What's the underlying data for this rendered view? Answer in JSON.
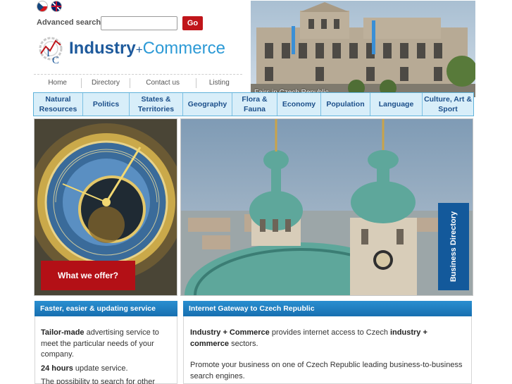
{
  "header": {
    "languages": [
      {
        "code": "cz",
        "icon": "czech-flag-icon"
      },
      {
        "code": "en",
        "icon": "uk-flag-icon"
      }
    ],
    "advanced_search_label": "Advanced search",
    "search_value": "",
    "go_label": "Go",
    "logo": {
      "word1": "Industry",
      "plus": "+",
      "word2": "Commerce",
      "mark_letters": "I C"
    },
    "nav": [
      "Home",
      "Directory",
      "Contact us",
      "Listing"
    ],
    "photo_caption": "Fairs in Czech Republic"
  },
  "categories": [
    {
      "label": "Natural Resources"
    },
    {
      "label": "Politics"
    },
    {
      "label": "States & Territories"
    },
    {
      "label": "Geography"
    },
    {
      "label": "Flora & Fauna"
    },
    {
      "label": "Economy"
    },
    {
      "label": "Population"
    },
    {
      "label": "Language"
    },
    {
      "label": "Culture, Art & Sport"
    }
  ],
  "promo": {
    "offer_label": "What we offer?",
    "business_directory_label": "Business Directory"
  },
  "left_box": {
    "title": "Faster, easier & updating service",
    "p1_bold": "Tailor-made",
    "p1_text": " advertising service to meet the particular needs of your company.",
    "p2_bold": "24 hours",
    "p2_text": " update service.",
    "p3_text": "The possibility to search for other"
  },
  "right_box": {
    "title": "Internet Gateway to Czech Republic",
    "p1_bold1": "Industry + Commerce",
    "p1_text1": " provides internet access to Czech ",
    "p1_bold2": "industry + commerce",
    "p1_text2": " sectors.",
    "p2_text": "Promote your business on one of Czech Republic leading business-to-business search engines."
  },
  "colors": {
    "accent_red": "#c0151a",
    "brand_blue": "#1e5a9c",
    "menu_bg": "#d8eef9",
    "box_title_bg": "#1f7fc0"
  }
}
